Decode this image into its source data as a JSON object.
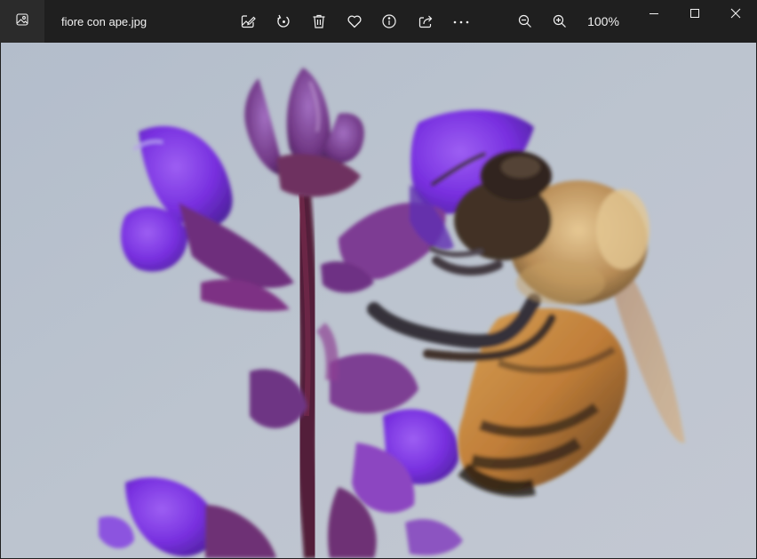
{
  "window": {
    "file_name": "fiore con ape.jpg",
    "zoom_level": "100%"
  },
  "toolbar": {
    "items": [
      {
        "name": "edit-image-button",
        "icon": "edit-image-icon"
      },
      {
        "name": "rotate-button",
        "icon": "rotate-icon"
      },
      {
        "name": "delete-button",
        "icon": "trash-icon"
      },
      {
        "name": "favorite-button",
        "icon": "heart-icon"
      },
      {
        "name": "info-button",
        "icon": "info-icon"
      },
      {
        "name": "share-button",
        "icon": "share-icon"
      },
      {
        "name": "more-button",
        "icon": "more-icon"
      },
      {
        "name": "zoom-out-button",
        "icon": "zoom-out-icon"
      },
      {
        "name": "zoom-in-button",
        "icon": "zoom-in-icon"
      }
    ]
  },
  "caption_buttons": [
    "minimize-icon",
    "maximize-icon",
    "close-icon"
  ],
  "colors": {
    "titlebar": "#1f1f1f",
    "icon": "#f2f2f2",
    "background": "#b7c0cc",
    "petal": "#7a2ee6",
    "stem": "#5a1430",
    "bee_body": "#c88a3a",
    "bee_dark": "#2a2016"
  }
}
